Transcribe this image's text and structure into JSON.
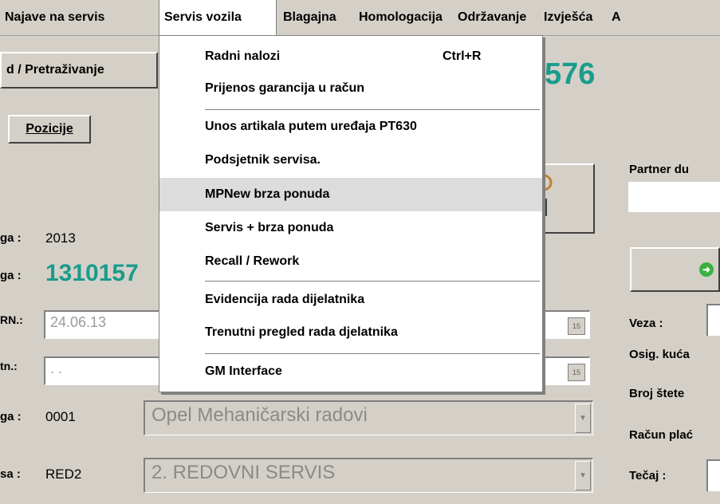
{
  "menu": {
    "items": [
      "Najave na servis",
      "Servis vozila",
      "Blagajna",
      "Homologacija",
      "Održavanje",
      "Izvješća",
      "A"
    ]
  },
  "dropdown": {
    "items": [
      {
        "label": "Radni nalozi",
        "shortcut": "Ctrl+R"
      },
      {
        "label": "Prijenos garancija u račun"
      },
      {
        "label": "Unos artikala putem uređaja PT630"
      },
      {
        "label": "Podsjetnik servisa."
      },
      {
        "label": "MPNew brza ponuda",
        "highlighted": true
      },
      {
        "label": "Servis + brza ponuda"
      },
      {
        "label": "Recall / Rework"
      },
      {
        "label": "Evidencija rada dijelatnika"
      },
      {
        "label": "Trenutni pregled rada djelatnika"
      },
      {
        "label": "GM Interface"
      }
    ]
  },
  "toolbar": {
    "search_button": "d / Pretraživanje",
    "pozicije_button": "Pozicije",
    "number_partial": "576"
  },
  "form": {
    "godina_label": "ga :",
    "godina_value": "2013",
    "broj_label": "ga :",
    "broj_value": "1310157",
    "datum_rn_label": "RN.:",
    "datum_rn_value": "24.06.13",
    "datum2_label": "tn.:",
    "datum2_value": ". .",
    "vrsta_label": "ga :",
    "vrsta_code": "0001",
    "vrsta_value": "Opel Mehaničarski radovi",
    "servis_label": "sa :",
    "servis_code": "RED2",
    "servis_value": "2. REDOVNI SERVIS",
    "calendar_icon_text": "15"
  },
  "right_panel": {
    "partner": "Partner du",
    "veza": "Veza :",
    "osig": "Osig. kuća",
    "broj_stete": "Broj štete",
    "racun": "Račun plać",
    "tecaj": "Tečaj :"
  },
  "colors": {
    "accent_number": "#1a9c8c",
    "menu_bg": "#d4d0c8",
    "highlight": "#dcdcdc"
  }
}
